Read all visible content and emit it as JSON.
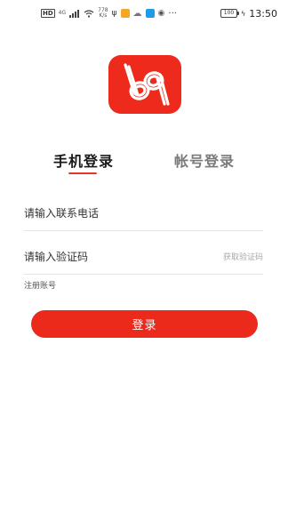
{
  "status_bar": {
    "hd": "HD",
    "net_type": "4G",
    "speed_value": "778",
    "speed_unit": "K/s",
    "more": "···",
    "battery": "100",
    "time": "13:50"
  },
  "tabs": {
    "phone_login": "手机登录",
    "account_login": "帐号登录",
    "active": "phone_login"
  },
  "form": {
    "phone_placeholder": "请输入联系电话",
    "code_placeholder": "请输入验证码",
    "get_code_label": "获取验证码"
  },
  "register_link": "注册账号",
  "login_button": "登录",
  "colors": {
    "brand": "#ec2a1b",
    "tab_active": "#1a1a1a",
    "tab_inactive": "#7a7a7a",
    "underline": "#e8342a"
  },
  "icons": {
    "logo": "bq-logo-icon"
  }
}
